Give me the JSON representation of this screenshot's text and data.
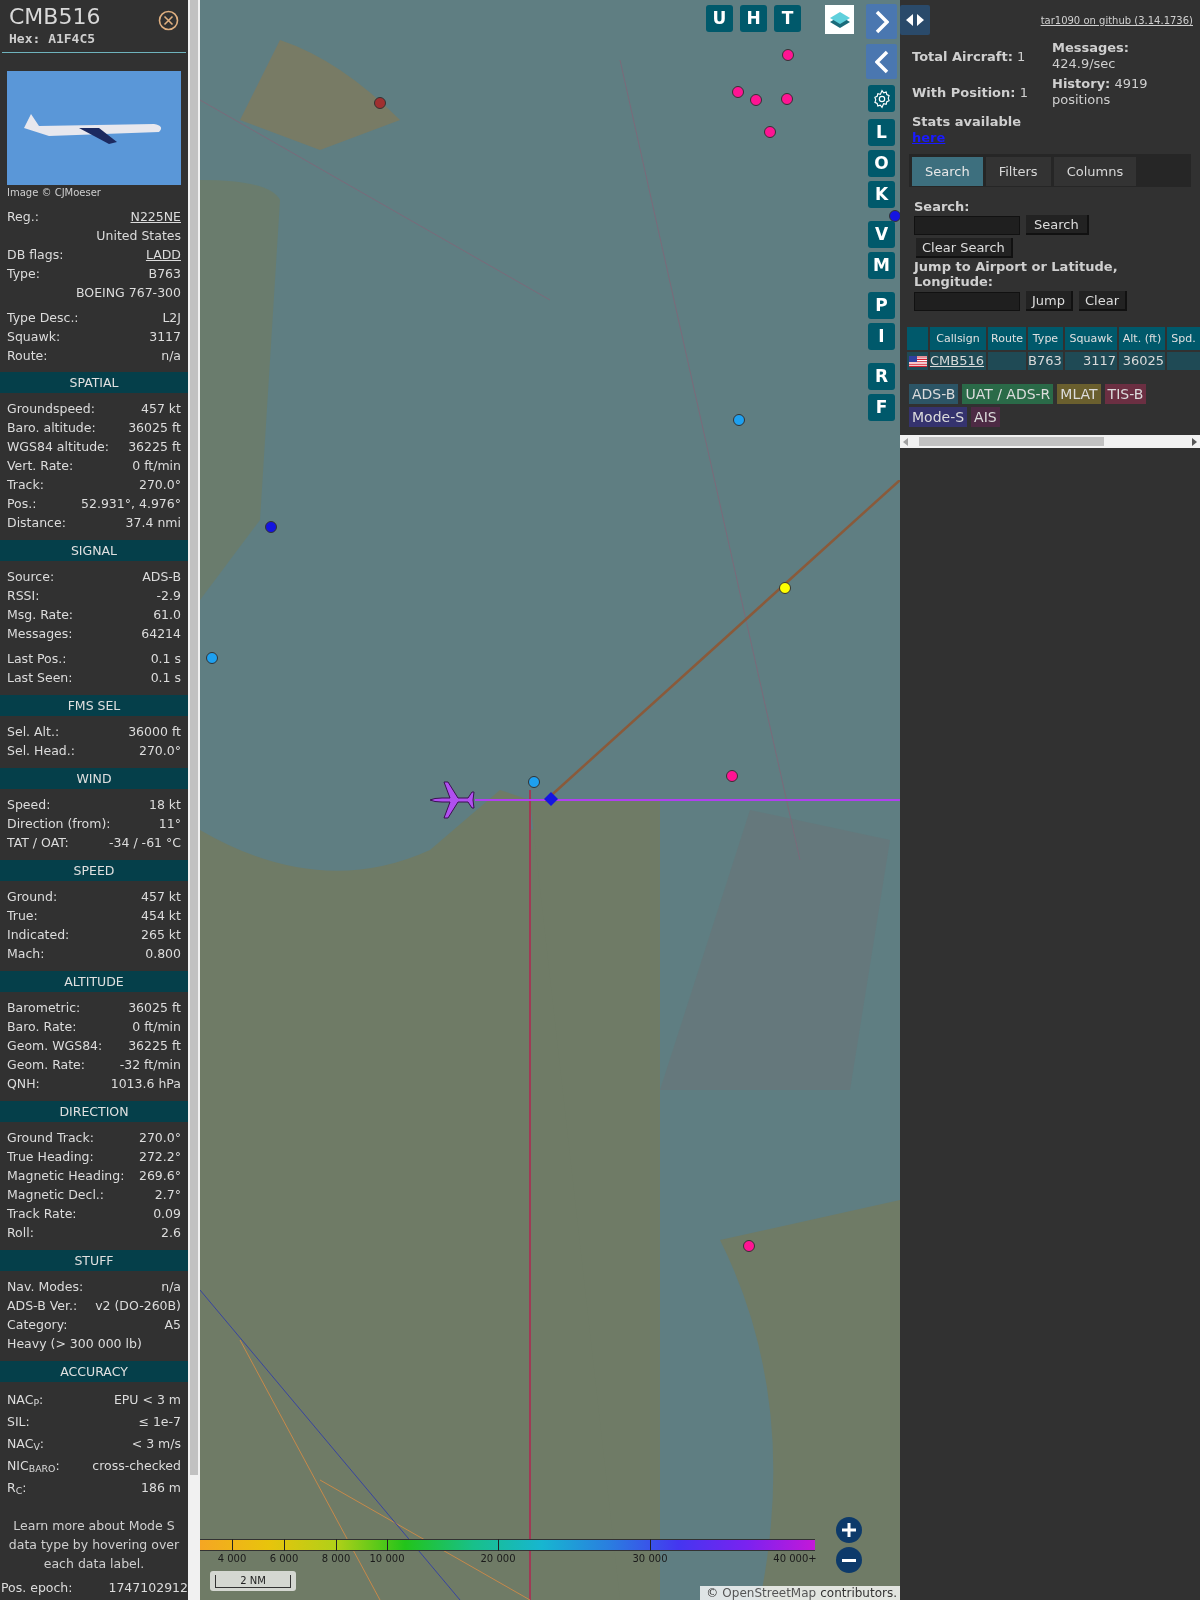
{
  "aircraft_panel": {
    "callsign": "CMB516",
    "hex": "Hex: A1F4C5",
    "photo_credit": "Image © CJMoeser",
    "info_groups": [
      [
        {
          "kind": "pair",
          "label": "Reg.:",
          "value": "N225NE",
          "link": true
        },
        {
          "kind": "value",
          "value": "United States",
          "link": false
        },
        {
          "kind": "pair",
          "label": "DB flags:",
          "value": "LADD",
          "link": true
        },
        {
          "kind": "pair",
          "label": "Type:",
          "value": "B763",
          "link": false
        },
        {
          "kind": "value",
          "value": "BOEING 767-300",
          "link": false
        }
      ],
      [
        {
          "kind": "pair",
          "label": "Type Desc.:",
          "value": "L2J",
          "link": false
        },
        {
          "kind": "pair",
          "label": "Squawk:",
          "value": "3117",
          "link": false
        },
        {
          "kind": "pair",
          "label": "Route:",
          "value": "n/a",
          "link": false
        }
      ]
    ],
    "sections": [
      {
        "title": "SPATIAL",
        "groups": [
          [
            {
              "kind": "pair",
              "label": "Groundspeed:",
              "value": "457 kt"
            },
            {
              "kind": "pair",
              "label": "Baro. altitude:",
              "value": "36025 ft"
            },
            {
              "kind": "pair",
              "label": "WGS84 altitude:",
              "value": "36225 ft"
            },
            {
              "kind": "pair",
              "label": "Vert. Rate:",
              "value": "0 ft/min"
            },
            {
              "kind": "pair",
              "label": "Track:",
              "value": "270.0°"
            },
            {
              "kind": "pair",
              "label": "Pos.:",
              "value": "52.931°, 4.976°"
            },
            {
              "kind": "pair",
              "label": "Distance:",
              "value": "37.4 nmi"
            }
          ]
        ]
      },
      {
        "title": "SIGNAL",
        "groups": [
          [
            {
              "kind": "pair",
              "label": "Source:",
              "value": "ADS-B"
            },
            {
              "kind": "pair",
              "label": "RSSI:",
              "value": "-2.9"
            },
            {
              "kind": "pair",
              "label": "Msg. Rate:",
              "value": "61.0"
            },
            {
              "kind": "pair",
              "label": "Messages:",
              "value": "64214"
            }
          ],
          [
            {
              "kind": "pair",
              "label": "Last Pos.:",
              "value": "0.1 s"
            },
            {
              "kind": "pair",
              "label": "Last Seen:",
              "value": "0.1 s"
            }
          ]
        ]
      },
      {
        "title": "FMS SEL",
        "groups": [
          [
            {
              "kind": "pair",
              "label": "Sel. Alt.:",
              "value": "36000 ft"
            },
            {
              "kind": "pair",
              "label": "Sel. Head.:",
              "value": "270.0°"
            }
          ]
        ]
      },
      {
        "title": "WIND",
        "groups": [
          [
            {
              "kind": "pair",
              "label": "Speed:",
              "value": "18 kt"
            },
            {
              "kind": "pair",
              "label": "Direction (from):",
              "value": "11°"
            },
            {
              "kind": "pair",
              "label": "TAT / OAT:",
              "value": "-34 / -61 °C"
            }
          ]
        ]
      },
      {
        "title": "SPEED",
        "groups": [
          [
            {
              "kind": "pair",
              "label": "Ground:",
              "value": "457 kt"
            },
            {
              "kind": "pair",
              "label": "True:",
              "value": "454 kt"
            },
            {
              "kind": "pair",
              "label": "Indicated:",
              "value": "265 kt"
            },
            {
              "kind": "pair",
              "label": "Mach:",
              "value": "0.800"
            }
          ]
        ]
      },
      {
        "title": "ALTITUDE",
        "groups": [
          [
            {
              "kind": "pair",
              "label": "Barometric:",
              "value": "36025 ft"
            },
            {
              "kind": "pair",
              "label": "Baro. Rate:",
              "value": "0 ft/min"
            },
            {
              "kind": "pair",
              "label": "Geom. WGS84:",
              "value": "36225 ft"
            },
            {
              "kind": "pair",
              "label": "Geom. Rate:",
              "value": "-32 ft/min"
            },
            {
              "kind": "pair",
              "label": "QNH:",
              "value": "1013.6 hPa"
            }
          ]
        ]
      },
      {
        "title": "DIRECTION",
        "groups": [
          [
            {
              "kind": "pair",
              "label": "Ground Track:",
              "value": "270.0°"
            },
            {
              "kind": "pair",
              "label": "True Heading:",
              "value": "272.2°"
            },
            {
              "kind": "pair",
              "label": "Magnetic Heading:",
              "value": "269.6°"
            },
            {
              "kind": "pair",
              "label": "Magnetic Decl.:",
              "value": "2.7°"
            },
            {
              "kind": "pair",
              "label": "Track Rate:",
              "value": "0.09"
            },
            {
              "kind": "pair",
              "label": "Roll:",
              "value": "2.6"
            }
          ]
        ]
      },
      {
        "title": "STUFF",
        "groups": [
          [
            {
              "kind": "pair",
              "label": "Nav. Modes:",
              "value": "n/a"
            },
            {
              "kind": "pair",
              "label": "ADS-B Ver.:",
              "value": "v2 (DO-260B)"
            },
            {
              "kind": "pair",
              "label": "Category:",
              "value": "A5"
            },
            {
              "kind": "label",
              "label": "Heavy (> 300 000 lb)"
            }
          ]
        ]
      },
      {
        "title": "ACCURACY",
        "groups": [
          [
            {
              "kind": "tall",
              "label": "NAC$_{P}$:",
              "value": "EPU < 3 m"
            },
            {
              "kind": "tall",
              "label": "SIL:",
              "value": "≤ 1e-7"
            },
            {
              "kind": "tall",
              "label": "NAC$_{V}$:",
              "value": "< 3 m/s"
            },
            {
              "kind": "tall",
              "label": "NIC$_{BARO}$:",
              "value": "cross-checked"
            },
            {
              "kind": "tall",
              "label": "R$_{C}$:",
              "value": "186 m"
            }
          ]
        ]
      }
    ],
    "note": "Learn more about Mode S data type by hovering over each data label.",
    "footer_row": {
      "label": "Pos. epoch:",
      "value": "1747102912"
    }
  },
  "map": {
    "top_buttons": [
      "U",
      "H",
      "T"
    ],
    "side_button_groups": [
      [
        "L",
        "O",
        "K"
      ],
      [
        "V",
        "M"
      ],
      [
        "P",
        "I"
      ],
      [
        "R",
        "F"
      ]
    ],
    "altitude_legend": [
      "4 000",
      "6 000",
      "8 000",
      "10 000",
      "20 000",
      "30 000",
      "40 000+"
    ],
    "scale": "2 NM",
    "attribution": {
      "prefix": "©",
      "link": "OpenStreetMap",
      "suffix": "contributors."
    }
  },
  "stats_panel": {
    "github_link": "tar1090 on github (3.14.1736)",
    "stats": [
      "**Total Aircraft:** 1",
      "**Messages:** 424.9/sec",
      "**With Position:** 1",
      "**History:** 4919 positions"
    ],
    "stats_text": "Stats available",
    "stats_link": "here",
    "tabs": [
      {
        "label": "Search",
        "selected": true
      },
      {
        "label": "Filters",
        "selected": false
      },
      {
        "label": "Columns",
        "selected": false
      }
    ],
    "search": {
      "label": "Search:",
      "button": "Search",
      "clear_button": "Clear Search",
      "jump_label": "Jump to Airport or Latitude, Longitude:",
      "jump_button": "Jump",
      "jump_clear_button": "Clear"
    },
    "table": {
      "columns": [
        "Callsign",
        "Route",
        "Type",
        "Squawk",
        "Alt. (ft)",
        "Spd."
      ],
      "rows": [
        {
          "callsign": "CMB516",
          "type": "B763",
          "squawk": "3117",
          "altitude": "36025"
        }
      ]
    },
    "sources": [
      {
        "label": "ADS-B",
        "color": "#2c5566"
      },
      {
        "label": "UAT / ADS-R",
        "color": "#2a6a48"
      },
      {
        "label": "MLAT",
        "color": "#6a5f2e"
      },
      {
        "label": "TIS-B",
        "color": "#6b2f42"
      },
      {
        "label": "Mode-S",
        "color": "#35336e"
      },
      {
        "label": "AIS",
        "color": "#4d2a44"
      }
    ]
  }
}
